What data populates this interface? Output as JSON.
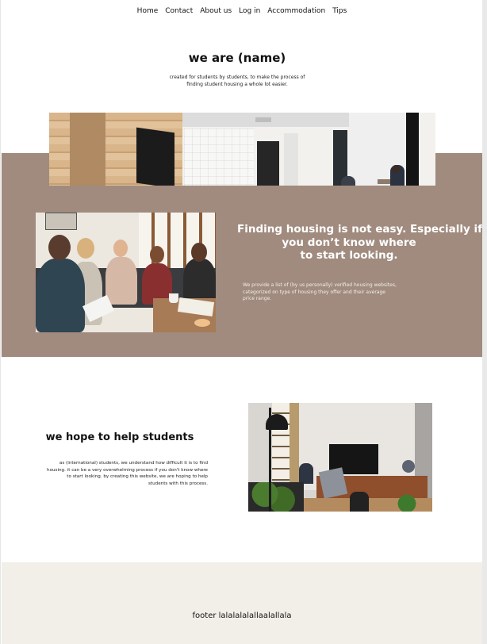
{
  "nav": {
    "items": [
      "Home",
      "Contact",
      "About us",
      "Log in",
      "Accommodation",
      "Tips"
    ]
  },
  "hero": {
    "title": "we are (name)",
    "subtitle_lines": [
      "created for students by students, to make the process of",
      "finding student housing a whole lot easier."
    ]
  },
  "band": {
    "heading_lines": [
      "Finding housing is not easy. Especially if",
      "you don’t know where",
      "to start looking."
    ],
    "body_lines": [
      "We provide a list of (by us personally) verified housing websites,",
      "categorized on type of housing they offer and their average",
      "price range."
    ],
    "background_color": "#a08b7e"
  },
  "help": {
    "heading": "we hope to help students",
    "body_lines": [
      "as (international) students, we understand how difficult it is to find",
      "housing. it can be a very overwhelming process if you don't know where",
      "to start looking. by creating this website, we are hoping to help",
      "students with this process."
    ]
  },
  "footer": {
    "text": "footer lalalalalallaalallala",
    "background_color": "#f2efe8"
  }
}
